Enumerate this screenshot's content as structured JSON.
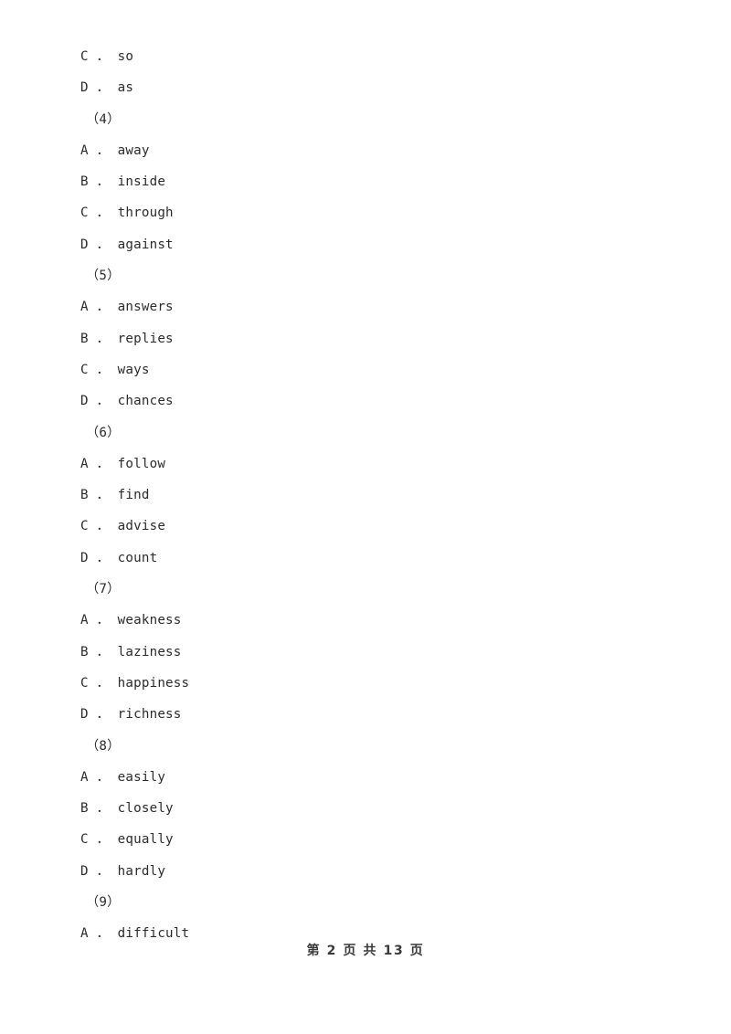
{
  "document": {
    "page_background": "#ffffff",
    "text_color": "#2b2b2b",
    "lines": [
      {
        "type": "option",
        "text": "C ． so"
      },
      {
        "type": "option",
        "text": "D ． as"
      },
      {
        "type": "qnum",
        "text": "（4）"
      },
      {
        "type": "option",
        "text": "A ． away"
      },
      {
        "type": "option",
        "text": "B ． inside"
      },
      {
        "type": "option",
        "text": "C ． through"
      },
      {
        "type": "option",
        "text": "D ． against"
      },
      {
        "type": "qnum",
        "text": "（5）"
      },
      {
        "type": "option",
        "text": "A ． answers"
      },
      {
        "type": "option",
        "text": "B ． replies"
      },
      {
        "type": "option",
        "text": "C ． ways"
      },
      {
        "type": "option",
        "text": "D ． chances"
      },
      {
        "type": "qnum",
        "text": "（6）"
      },
      {
        "type": "option",
        "text": "A ． follow"
      },
      {
        "type": "option",
        "text": "B ． find"
      },
      {
        "type": "option",
        "text": "C ． advise"
      },
      {
        "type": "option",
        "text": "D ． count"
      },
      {
        "type": "qnum",
        "text": "（7）"
      },
      {
        "type": "option",
        "text": "A ． weakness"
      },
      {
        "type": "option",
        "text": "B ． laziness"
      },
      {
        "type": "option",
        "text": "C ． happiness"
      },
      {
        "type": "option",
        "text": "D ． richness"
      },
      {
        "type": "qnum",
        "text": "（8）"
      },
      {
        "type": "option",
        "text": "A ． easily"
      },
      {
        "type": "option",
        "text": "B ． closely"
      },
      {
        "type": "option",
        "text": "C ． equally"
      },
      {
        "type": "option",
        "text": "D ． hardly"
      },
      {
        "type": "qnum",
        "text": "（9）"
      },
      {
        "type": "option",
        "text": "A ． difficult"
      }
    ]
  },
  "footer": {
    "text": "第 2 页 共 13 页",
    "current_page": "2",
    "total_pages": "13"
  }
}
